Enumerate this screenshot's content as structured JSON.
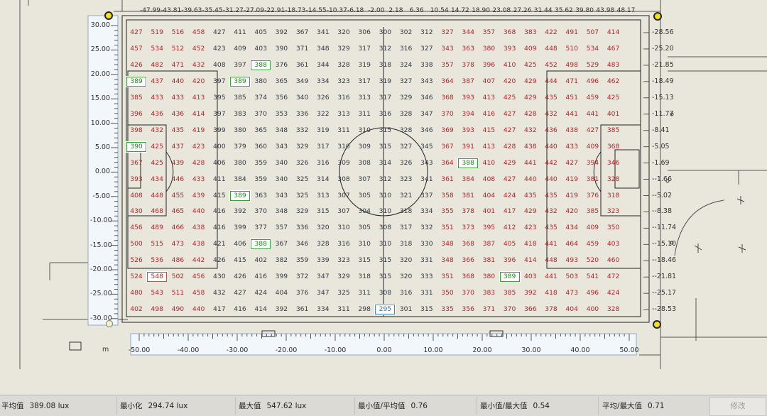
{
  "grid": {
    "rows": [
      [
        "427",
        "519",
        "516",
        "458",
        "427",
        "411",
        "405",
        "392",
        "367",
        "341",
        "320",
        "306",
        "300",
        "302",
        "312",
        "327",
        "344",
        "357",
        "368",
        "383",
        "422",
        "491",
        "507",
        "414"
      ],
      [
        "457",
        "534",
        "512",
        "452",
        "423",
        "409",
        "403",
        "390",
        "371",
        "348",
        "329",
        "317",
        "312",
        "316",
        "327",
        "343",
        "363",
        "380",
        "393",
        "409",
        "448",
        "510",
        "534",
        "467"
      ],
      [
        "426",
        "482",
        "471",
        "432",
        "408",
        "397",
        "388",
        "376",
        "361",
        "344",
        "328",
        "319",
        "318",
        "324",
        "338",
        "357",
        "378",
        "396",
        "410",
        "425",
        "452",
        "498",
        "529",
        "483"
      ],
      [
        "389",
        "437",
        "440",
        "420",
        "397",
        "389",
        "380",
        "365",
        "349",
        "334",
        "323",
        "317",
        "319",
        "327",
        "343",
        "364",
        "387",
        "407",
        "420",
        "429",
        "444",
        "471",
        "496",
        "462"
      ],
      [
        "385",
        "433",
        "433",
        "413",
        "395",
        "385",
        "374",
        "356",
        "340",
        "326",
        "316",
        "313",
        "317",
        "329",
        "346",
        "368",
        "393",
        "413",
        "425",
        "429",
        "435",
        "451",
        "459",
        "425"
      ],
      [
        "396",
        "436",
        "436",
        "414",
        "397",
        "383",
        "370",
        "353",
        "336",
        "322",
        "313",
        "311",
        "316",
        "328",
        "347",
        "370",
        "394",
        "416",
        "427",
        "428",
        "432",
        "441",
        "441",
        "401"
      ],
      [
        "398",
        "432",
        "435",
        "419",
        "399",
        "380",
        "365",
        "348",
        "332",
        "319",
        "311",
        "310",
        "315",
        "328",
        "346",
        "369",
        "393",
        "415",
        "427",
        "432",
        "436",
        "438",
        "427",
        "385"
      ],
      [
        "390",
        "425",
        "437",
        "423",
        "400",
        "379",
        "360",
        "343",
        "329",
        "317",
        "310",
        "309",
        "315",
        "327",
        "345",
        "367",
        "391",
        "413",
        "428",
        "438",
        "440",
        "433",
        "409",
        "368"
      ],
      [
        "367",
        "425",
        "439",
        "428",
        "406",
        "380",
        "359",
        "340",
        "326",
        "316",
        "309",
        "308",
        "314",
        "326",
        "343",
        "364",
        "388",
        "410",
        "429",
        "441",
        "442",
        "427",
        "394",
        "346"
      ],
      [
        "393",
        "434",
        "446",
        "433",
        "411",
        "384",
        "359",
        "340",
        "325",
        "314",
        "308",
        "307",
        "312",
        "323",
        "341",
        "361",
        "384",
        "408",
        "427",
        "440",
        "440",
        "419",
        "381",
        "328"
      ],
      [
        "408",
        "448",
        "455",
        "439",
        "415",
        "389",
        "363",
        "343",
        "325",
        "313",
        "307",
        "305",
        "310",
        "321",
        "337",
        "358",
        "381",
        "404",
        "424",
        "435",
        "435",
        "419",
        "376",
        "318"
      ],
      [
        "430",
        "468",
        "465",
        "440",
        "416",
        "392",
        "370",
        "348",
        "329",
        "315",
        "307",
        "304",
        "310",
        "318",
        "334",
        "355",
        "378",
        "401",
        "417",
        "429",
        "432",
        "420",
        "385",
        "323"
      ],
      [
        "456",
        "489",
        "466",
        "438",
        "416",
        "399",
        "377",
        "357",
        "336",
        "320",
        "310",
        "305",
        "308",
        "317",
        "332",
        "351",
        "373",
        "395",
        "412",
        "423",
        "435",
        "434",
        "409",
        "350"
      ],
      [
        "500",
        "515",
        "473",
        "438",
        "421",
        "406",
        "388",
        "367",
        "346",
        "328",
        "316",
        "310",
        "310",
        "318",
        "330",
        "348",
        "368",
        "387",
        "405",
        "418",
        "441",
        "464",
        "459",
        "403"
      ],
      [
        "526",
        "536",
        "486",
        "442",
        "426",
        "415",
        "402",
        "382",
        "359",
        "339",
        "323",
        "315",
        "315",
        "320",
        "331",
        "348",
        "366",
        "381",
        "396",
        "414",
        "448",
        "493",
        "520",
        "460"
      ],
      [
        "524",
        "548",
        "502",
        "456",
        "430",
        "426",
        "416",
        "399",
        "372",
        "347",
        "329",
        "318",
        "315",
        "320",
        "333",
        "351",
        "368",
        "380",
        "389",
        "403",
        "441",
        "503",
        "541",
        "472"
      ],
      [
        "480",
        "543",
        "511",
        "458",
        "432",
        "427",
        "424",
        "404",
        "376",
        "347",
        "325",
        "311",
        "308",
        "316",
        "331",
        "350",
        "370",
        "383",
        "385",
        "392",
        "418",
        "473",
        "496",
        "424"
      ],
      [
        "402",
        "498",
        "490",
        "440",
        "417",
        "416",
        "414",
        "392",
        "361",
        "334",
        "311",
        "298",
        "295",
        "301",
        "315",
        "335",
        "356",
        "371",
        "370",
        "366",
        "378",
        "404",
        "400",
        "328"
      ]
    ],
    "highlights": [
      {
        "r": 2,
        "c": 6,
        "kind": "g"
      },
      {
        "r": 3,
        "c": 0,
        "kind": "g"
      },
      {
        "r": 3,
        "c": 5,
        "kind": "g"
      },
      {
        "r": 7,
        "c": 0,
        "kind": "g"
      },
      {
        "r": 8,
        "c": 16,
        "kind": "g"
      },
      {
        "r": 10,
        "c": 5,
        "kind": "g"
      },
      {
        "r": 13,
        "c": 6,
        "kind": "g"
      },
      {
        "r": 15,
        "c": 18,
        "kind": "g"
      },
      {
        "r": 15,
        "c": 1,
        "kind": "r"
      },
      {
        "r": 17,
        "c": 12,
        "kind": "b"
      }
    ],
    "colors": {
      "red": "#b3262a",
      "dark": "#333a44",
      "min_box": "#3a8ad6",
      "max_box": "#d84a4a",
      "avg_box": "#2fa82f"
    }
  },
  "rulers": {
    "left": [
      "30.00",
      "25.00",
      "20.00",
      "15.00",
      "10.00",
      "5.00",
      "0.00",
      "-5.00",
      "-10.00",
      "-15.00",
      "-20.00",
      "-25.00",
      "-30.00"
    ],
    "right": [
      "28.56",
      "25.20",
      "21.85",
      "18.49",
      "15.13",
      "11.77",
      "8.41",
      "5.05",
      "1.69",
      "-1.66",
      "-5.02",
      "-8.38",
      "-11.74",
      "-15.10",
      "-18.46",
      "-21.81",
      "-25.17",
      "-28.53"
    ],
    "bottom": [
      "-50.00",
      "-40.00",
      "-30.00",
      "-20.00",
      "-10.00",
      "0.00",
      "10.00",
      "20.00",
      "30.00",
      "40.00",
      "50.00"
    ],
    "top": [
      "-47.99",
      "-43.81",
      "-39.63",
      "-35.45",
      "-31.27",
      "-27.09",
      "-22.91",
      "-18.73",
      "-14.55",
      "-10.37",
      "-6.18",
      "-2.00",
      "2.18",
      "6.36",
      "10.54",
      "14.72",
      "18.90",
      "23.08",
      "27.26",
      "31.44",
      "35.62",
      "39.80",
      "43.98",
      "48.17"
    ],
    "unit_label": "m"
  },
  "status": {
    "avg_label": "平均值",
    "avg_value": "389.08 lux",
    "min_label": "最小化",
    "min_value": "294.74 lux",
    "max_label": "最大值",
    "max_value": "547.62 lux",
    "min_avg_label": "最小值/平均值",
    "min_avg_value": "0.76",
    "min_max_label": "最小值/最大值",
    "min_max_value": "0.54",
    "avg_max_label": "平均/最大值",
    "avg_max_value": "0.71",
    "modify_button": "修改"
  },
  "icons": {
    "marker": "pole-marker-icon"
  }
}
